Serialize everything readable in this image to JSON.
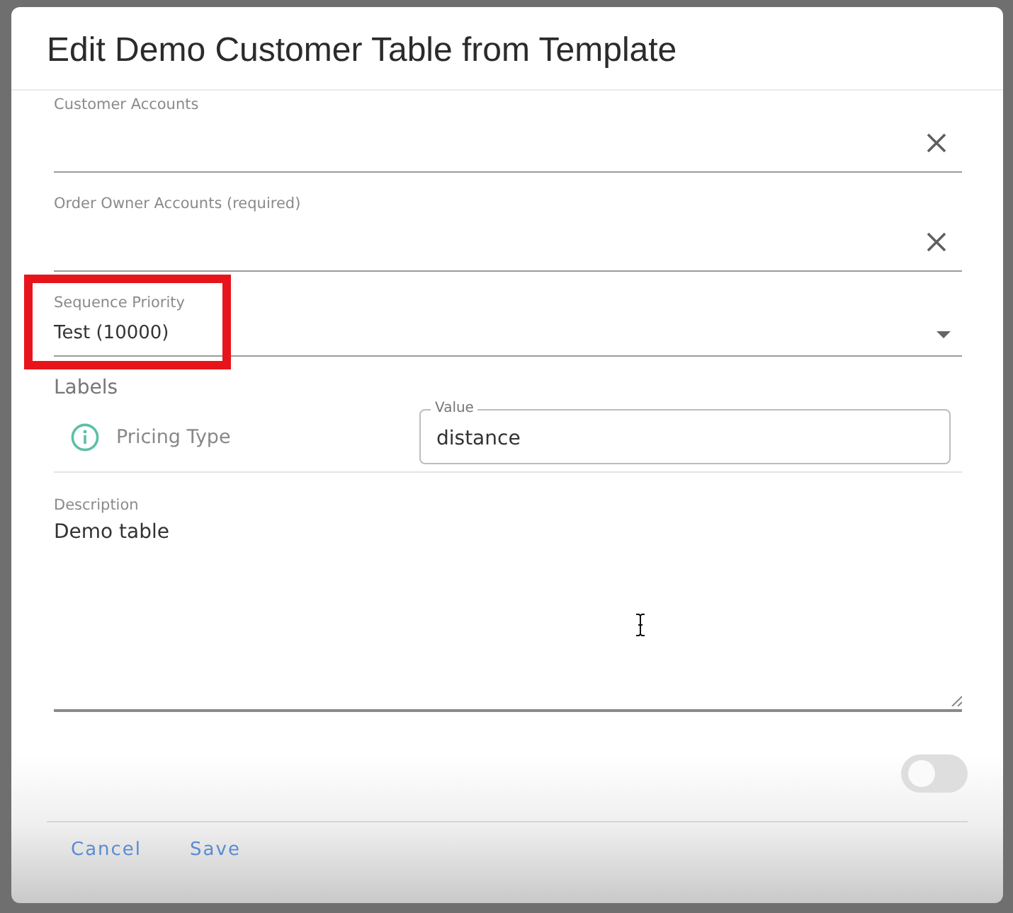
{
  "dialog": {
    "title": "Edit Demo Customer Table from Template"
  },
  "fields": [
    {
      "kind": "autocomplete",
      "label": "Customer Accounts",
      "highlighted": false
    },
    {
      "kind": "autocomplete",
      "label": "Order Owner Accounts (required)",
      "highlighted": false
    },
    {
      "kind": "select",
      "label": "Sequence Priority",
      "value": "Test (10000)",
      "highlighted": true
    }
  ],
  "labels": {
    "heading": "Labels",
    "rows": [
      {
        "name": "Pricing Type",
        "value_label": "Value",
        "value": "distance"
      }
    ]
  },
  "description": {
    "label": "Description",
    "value": "Demo table"
  },
  "toggle": {
    "on": false
  },
  "buttons": [
    "Cancel",
    "Save"
  ]
}
